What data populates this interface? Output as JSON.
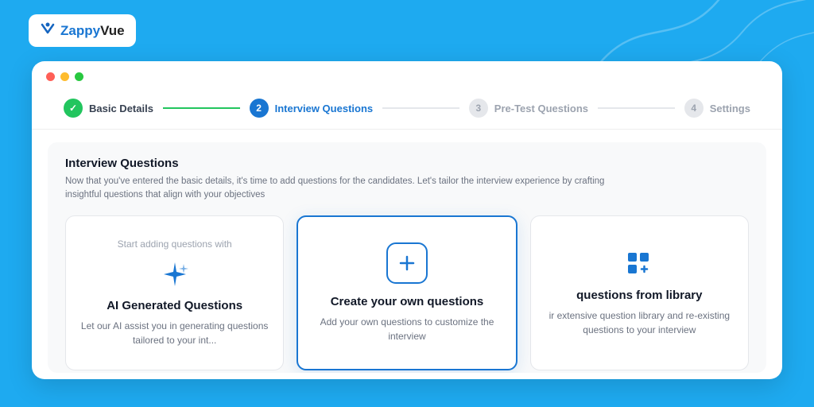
{
  "brand": {
    "logo_text_blue": "Zappy",
    "logo_text_dark": "Vue",
    "logo_symbol": "≥"
  },
  "stepper": {
    "steps": [
      {
        "id": "basic-details",
        "number": "✓",
        "label": "Basic Details",
        "state": "completed"
      },
      {
        "id": "interview-questions",
        "number": "2",
        "label": "Interview Questions",
        "state": "active"
      },
      {
        "id": "pre-test-questions",
        "number": "3",
        "label": "Pre-Test Questions",
        "state": "inactive"
      },
      {
        "id": "settings",
        "number": "4",
        "label": "Settings",
        "state": "inactive"
      }
    ]
  },
  "content": {
    "title": "Interview Questions",
    "description": "Now that you've entered the basic details, it's time to add questions for the candidates. Let's tailor the interview experience by crafting insightful questions that align with your objectives"
  },
  "cards": {
    "start_label": "Start adding questions with",
    "items": [
      {
        "id": "ai-generated",
        "title": "AI Generated Questions",
        "description": "Let our AI assist you in generating questions tailored to your int...",
        "state": "default"
      },
      {
        "id": "create-own",
        "title": "Create your own questions",
        "description": "Add your own questions to customize the interview",
        "state": "active"
      },
      {
        "id": "from-library",
        "title": "questions from library",
        "description": "ir extensive question library and re-existing questions to your interview",
        "state": "default"
      }
    ]
  }
}
